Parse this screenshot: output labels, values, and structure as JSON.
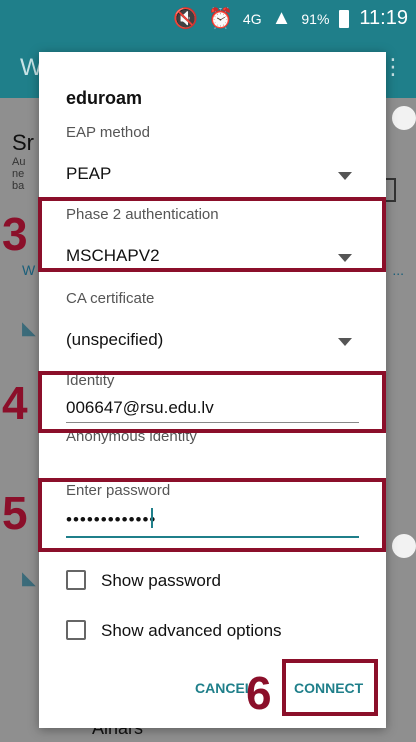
{
  "statusbar": {
    "icons": [
      "mute-icon",
      "alarm-icon",
      "network-4g-icon",
      "signal-icon"
    ],
    "network": "4G",
    "battery": "91%",
    "time": "11:19"
  },
  "background": {
    "appbar_letter": "W",
    "section_title_partial": "Sr",
    "section_desc_partial": "Au\nne\nba",
    "link_partial": "W",
    "link_dots": "...",
    "bottom_network": "Ainars"
  },
  "dialog": {
    "title": "eduroam",
    "eap": {
      "label": "EAP method",
      "value": "PEAP"
    },
    "phase2": {
      "label": "Phase 2 authentication",
      "value": "MSCHAPV2"
    },
    "ca": {
      "label": "CA certificate",
      "value": "(unspecified)"
    },
    "identity": {
      "label": "Identity",
      "value": "006647@rsu.edu.lv"
    },
    "anonymous": {
      "label": "Anonymous identity"
    },
    "password": {
      "label": "Enter password",
      "value": "•••••••••••••"
    },
    "show_password": {
      "label": "Show password"
    },
    "show_advanced": {
      "label": "Show advanced options"
    },
    "buttons": {
      "cancel": "CANCEL",
      "connect": "CONNECT"
    }
  },
  "annotations": {
    "n3": "3",
    "n4": "4",
    "n5": "5",
    "n6": "6"
  },
  "colors": {
    "accent": "#1f7f8a",
    "annotation": "#8b0f2a"
  }
}
